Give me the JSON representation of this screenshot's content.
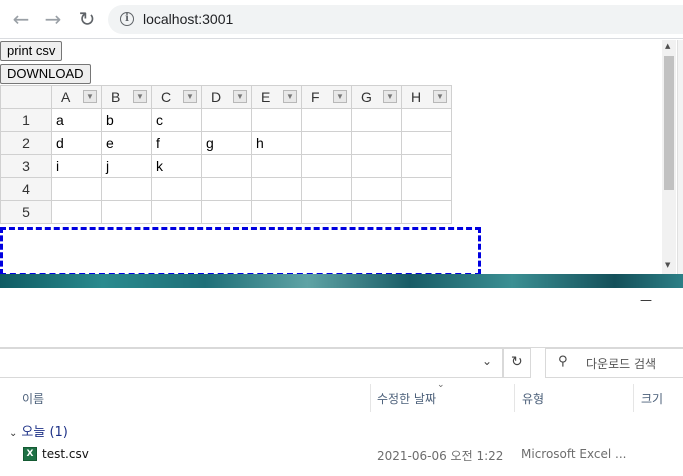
{
  "browser": {
    "url": "localhost:3001"
  },
  "page": {
    "print_button": "print csv",
    "download_button": "DOWNLOAD",
    "columns": [
      "A",
      "B",
      "C",
      "D",
      "E",
      "F",
      "G",
      "H"
    ],
    "rows": [
      {
        "num": "1",
        "cells": [
          "a",
          "b",
          "c",
          "",
          "",
          "",
          "",
          ""
        ]
      },
      {
        "num": "2",
        "cells": [
          "d",
          "e",
          "f",
          "g",
          "h",
          "",
          "",
          ""
        ]
      },
      {
        "num": "3",
        "cells": [
          "i",
          "j",
          "k",
          "",
          "",
          "",
          "",
          ""
        ]
      },
      {
        "num": "4",
        "cells": [
          "",
          "",
          "",
          "",
          "",
          "",
          "",
          ""
        ]
      },
      {
        "num": "5",
        "cells": [
          "",
          "",
          "",
          "",
          "",
          "",
          "",
          ""
        ]
      }
    ]
  },
  "explorer": {
    "minimize_glyph": "—",
    "search_placeholder": "다운로드 검색",
    "columns": {
      "name": "이름",
      "modified": "수정한 날짜",
      "type": "유형",
      "size": "크기"
    },
    "group_label": "오늘 (1)",
    "file": {
      "name": "test.csv",
      "modified": "2021-06-06 오전 1:22",
      "type": "Microsoft Excel ..."
    }
  },
  "colors": {
    "dashed_border": "#0000e0",
    "group_text": "#1e3287",
    "excel_green": "#1e7145"
  }
}
